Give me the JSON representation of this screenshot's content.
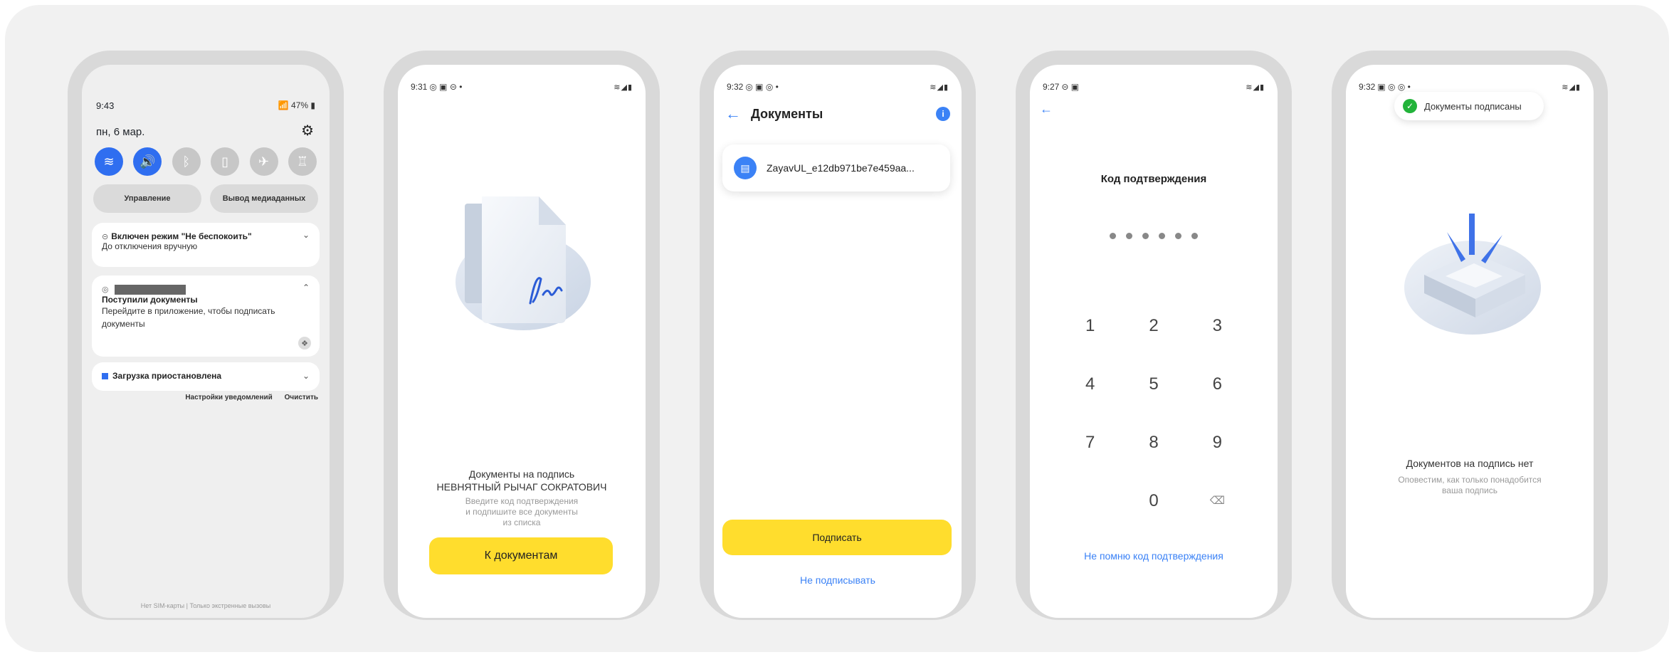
{
  "phone1": {
    "time": "9:43",
    "battery": "47%",
    "date": "пн, 6 мар.",
    "pill_left": "Управление",
    "pill_right": "Вывод медиаданных",
    "dnd_title": "Включен режим \"Не беспокоить\"",
    "dnd_sub": "До отключения вручную",
    "notif_title": "Поступили документы",
    "notif_body": "Перейдите в приложение, чтобы подписать документы",
    "download_title": "Загрузка приостановлена",
    "link_settings": "Настройки уведомлений",
    "link_clear": "Очистить",
    "footer": "Нет SIM-карты | Только экстренные вызовы"
  },
  "phone2": {
    "time": "9:31",
    "title": "Документы на подпись",
    "name": "НЕВНЯТНЫЙ РЫЧАГ СОКРАТОВИЧ",
    "hint": "Введите код подтверждения и подпишите все документы из списка",
    "button": "К документам"
  },
  "phone3": {
    "time": "9:32",
    "title": "Документы",
    "doc_name": "ZayavUL_e12db971be7e459aa...",
    "button": "Подписать",
    "link": "Не подписывать"
  },
  "phone4": {
    "time": "9:27",
    "title": "Код подтверждения",
    "keys": [
      "1",
      "2",
      "3",
      "4",
      "5",
      "6",
      "7",
      "8",
      "9",
      "",
      "0",
      "⌫"
    ],
    "link": "Не помню код подтверждения"
  },
  "phone5": {
    "time": "9:32",
    "toast": "Документы подписаны",
    "title": "Документов на подпись нет",
    "sub": "Оповестим, как только понадобится ваша подпись"
  },
  "colors": {
    "accent_blue": "#3b82f6",
    "yellow": "#ffdd2d",
    "success": "#22b33a"
  }
}
